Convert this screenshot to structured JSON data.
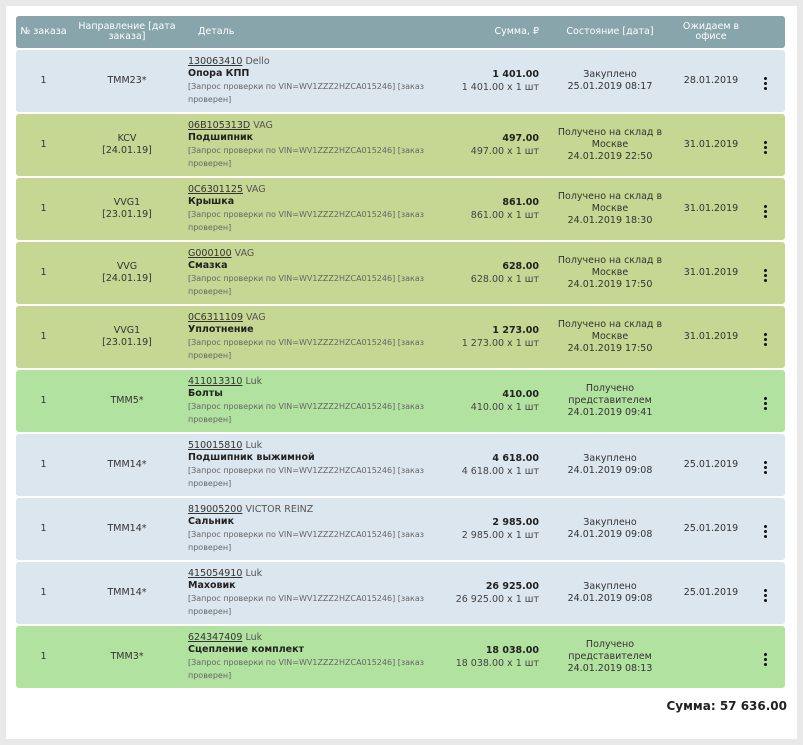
{
  "header": {
    "num": "№ заказа",
    "direction": "Направление [дата заказа]",
    "detail": "Деталь",
    "sum": "Сумма, ₽",
    "state": "Состояние [дата]",
    "expected": "Ожидаем в офисе"
  },
  "rows": [
    {
      "num": "1",
      "dir1": "TMM23*",
      "dir2": "",
      "art": "130063410",
      "brand": "Dello",
      "name": "Опора КПП",
      "note": "[Запрос проверки по VIN=WV1ZZZ2HZCA015246] [заказ проверен]",
      "sum": "1 401.00",
      "sum_sub": "1 401.00 x 1 шт",
      "st1": "Закуплено",
      "st2": "25.01.2019 08:17",
      "st3": "",
      "exp": "28.01.2019",
      "color": "blue"
    },
    {
      "num": "1",
      "dir1": "KCV",
      "dir2": "[24.01.19]",
      "art": "06B105313D",
      "brand": "VAG",
      "name": "Подшипник",
      "note": "[Запрос проверки по VIN=WV1ZZZ2HZCA015246] [заказ проверен]",
      "sum": "497.00",
      "sum_sub": "497.00 x 1 шт",
      "st1": "Получено на склад в",
      "st2": "Москве",
      "st3": "24.01.2019 22:50",
      "exp": "31.01.2019",
      "color": "olive"
    },
    {
      "num": "1",
      "dir1": "VVG1",
      "dir2": "[23.01.19]",
      "art": "0C6301125",
      "brand": "VAG",
      "name": "Крышка",
      "note": "[Запрос проверки по VIN=WV1ZZZ2HZCA015246] [заказ проверен]",
      "sum": "861.00",
      "sum_sub": "861.00 x 1 шт",
      "st1": "Получено на склад в",
      "st2": "Москве",
      "st3": "24.01.2019 18:30",
      "exp": "31.01.2019",
      "color": "olive"
    },
    {
      "num": "1",
      "dir1": "VVG",
      "dir2": "[24.01.19]",
      "art": "G000100",
      "brand": "VAG",
      "name": "Смазка",
      "note": "[Запрос проверки по VIN=WV1ZZZ2HZCA015246] [заказ проверен]",
      "sum": "628.00",
      "sum_sub": "628.00 x 1 шт",
      "st1": "Получено на склад в",
      "st2": "Москве",
      "st3": "24.01.2019 17:50",
      "exp": "31.01.2019",
      "color": "olive"
    },
    {
      "num": "1",
      "dir1": "VVG1",
      "dir2": "[23.01.19]",
      "art": "0C6311109",
      "brand": "VAG",
      "name": "Уплотнение",
      "note": "[Запрос проверки по VIN=WV1ZZZ2HZCA015246] [заказ проверен]",
      "sum": "1 273.00",
      "sum_sub": "1 273.00 x 1 шт",
      "st1": "Получено на склад в",
      "st2": "Москве",
      "st3": "24.01.2019 17:50",
      "exp": "31.01.2019",
      "color": "olive"
    },
    {
      "num": "1",
      "dir1": "TMM5*",
      "dir2": "",
      "art": "411013310",
      "brand": "Luk",
      "name": "Болты",
      "note": "[Запрос проверки по VIN=WV1ZZZ2HZCA015246] [заказ проверен]",
      "sum": "410.00",
      "sum_sub": "410.00 x 1 шт",
      "st1": "Получено",
      "st2": "представителем",
      "st3": "24.01.2019 09:41",
      "exp": "",
      "color": "green"
    },
    {
      "num": "1",
      "dir1": "TMM14*",
      "dir2": "",
      "art": "510015810",
      "brand": "Luk",
      "name": "Подшипник выжимной",
      "note": "[Запрос проверки по VIN=WV1ZZZ2HZCA015246] [заказ проверен]",
      "sum": "4 618.00",
      "sum_sub": "4 618.00 x 1 шт",
      "st1": "Закуплено",
      "st2": "24.01.2019 09:08",
      "st3": "",
      "exp": "25.01.2019",
      "color": "blue"
    },
    {
      "num": "1",
      "dir1": "TMM14*",
      "dir2": "",
      "art": "819005200",
      "brand": "VICTOR REINZ",
      "name": "Сальник",
      "note": "[Запрос проверки по VIN=WV1ZZZ2HZCA015246] [заказ проверен]",
      "sum": "2 985.00",
      "sum_sub": "2 985.00 x 1 шт",
      "st1": "Закуплено",
      "st2": "24.01.2019 09:08",
      "st3": "",
      "exp": "25.01.2019",
      "color": "blue"
    },
    {
      "num": "1",
      "dir1": "TMM14*",
      "dir2": "",
      "art": "415054910",
      "brand": "Luk",
      "name": "Маховик",
      "note": "[Запрос проверки по VIN=WV1ZZZ2HZCA015246] [заказ проверен]",
      "sum": "26 925.00",
      "sum_sub": "26 925.00 x 1 шт",
      "st1": "Закуплено",
      "st2": "24.01.2019 09:08",
      "st3": "",
      "exp": "25.01.2019",
      "color": "blue"
    },
    {
      "num": "1",
      "dir1": "TMM3*",
      "dir2": "",
      "art": "624347409",
      "brand": "Luk",
      "name": "Сцепление комплект",
      "note": "[Запрос проверки по VIN=WV1ZZZ2HZCA015246] [заказ проверен]",
      "sum": "18 038.00",
      "sum_sub": "18 038.00 x 1 шт",
      "st1": "Получено",
      "st2": "представителем",
      "st3": "24.01.2019 08:13",
      "exp": "",
      "color": "green"
    }
  ],
  "total": {
    "label": "Сумма:",
    "value": "57 636.00"
  },
  "colors": {
    "header": "#87a5ab",
    "blue": "#dce6ef",
    "olive": "#c5d793",
    "green": "#b2e2a0"
  },
  "icons": {
    "menu": "more-vertical-icon"
  }
}
